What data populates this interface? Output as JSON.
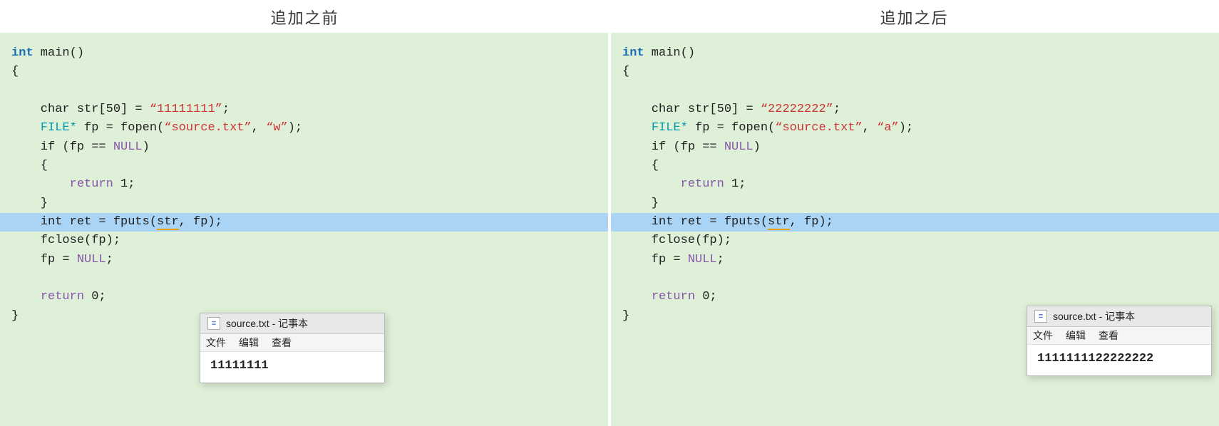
{
  "header": {
    "left_title": "追加之前",
    "right_title": "追加之后"
  },
  "left_panel": {
    "lines": [
      {
        "type": "normal",
        "parts": [
          {
            "text": "int",
            "cls": "kw"
          },
          {
            "text": " main()"
          }
        ]
      },
      {
        "type": "normal",
        "parts": [
          {
            "text": "{"
          }
        ]
      },
      {
        "type": "normal",
        "parts": []
      },
      {
        "type": "normal",
        "parts": [
          {
            "text": "    char str[50] = "
          },
          {
            "text": "“11111111”",
            "cls": "str"
          },
          {
            "text": ";"
          }
        ]
      },
      {
        "type": "normal",
        "parts": [
          {
            "text": "    "
          },
          {
            "text": "FILE*",
            "cls": "kw2"
          },
          {
            "text": " fp = fopen("
          },
          {
            "text": "“source.txt”",
            "cls": "str"
          },
          {
            "text": ", "
          },
          {
            "text": "“w”",
            "cls": "str"
          },
          {
            "text": ");"
          }
        ]
      },
      {
        "type": "normal",
        "parts": [
          {
            "text": "    if (fp == "
          },
          {
            "text": "NULL",
            "cls": "purple"
          },
          {
            "text": ")"
          }
        ]
      },
      {
        "type": "normal",
        "parts": [
          {
            "text": "    {"
          }
        ]
      },
      {
        "type": "normal",
        "parts": [
          {
            "text": "        "
          },
          {
            "text": "return",
            "cls": "purple"
          },
          {
            "text": " 1;"
          }
        ]
      },
      {
        "type": "normal",
        "parts": [
          {
            "text": "    }"
          }
        ]
      },
      {
        "type": "highlight",
        "parts": [
          {
            "text": "    int ret = fputs("
          },
          {
            "text": "str",
            "cls": "underline"
          },
          {
            "text": ", fp);"
          }
        ]
      },
      {
        "type": "normal",
        "parts": [
          {
            "text": "    fclose(fp);"
          }
        ]
      },
      {
        "type": "normal",
        "parts": [
          {
            "text": "    fp = "
          },
          {
            "text": "NULL",
            "cls": "purple"
          },
          {
            "text": ";"
          }
        ]
      },
      {
        "type": "normal",
        "parts": []
      },
      {
        "type": "normal",
        "parts": [
          {
            "text": "    "
          },
          {
            "text": "return",
            "cls": "purple"
          },
          {
            "text": " 0;"
          }
        ]
      },
      {
        "type": "normal",
        "parts": [
          {
            "text": "}"
          }
        ]
      }
    ]
  },
  "right_panel": {
    "lines": [
      {
        "type": "normal",
        "parts": [
          {
            "text": "int",
            "cls": "kw"
          },
          {
            "text": " main()"
          }
        ]
      },
      {
        "type": "normal",
        "parts": [
          {
            "text": "{"
          }
        ]
      },
      {
        "type": "normal",
        "parts": []
      },
      {
        "type": "normal",
        "parts": [
          {
            "text": "    char str[50] = "
          },
          {
            "text": "“22222222”",
            "cls": "str"
          },
          {
            "text": ";"
          }
        ]
      },
      {
        "type": "normal",
        "parts": [
          {
            "text": "    "
          },
          {
            "text": "FILE*",
            "cls": "kw2"
          },
          {
            "text": " fp = fopen("
          },
          {
            "text": "“source.txt”",
            "cls": "str"
          },
          {
            "text": ", "
          },
          {
            "text": "“a”",
            "cls": "str"
          },
          {
            "text": ");"
          }
        ]
      },
      {
        "type": "normal",
        "parts": [
          {
            "text": "    if (fp == "
          },
          {
            "text": "NULL",
            "cls": "purple"
          },
          {
            "text": ")"
          }
        ]
      },
      {
        "type": "normal",
        "parts": [
          {
            "text": "    {"
          }
        ]
      },
      {
        "type": "normal",
        "parts": [
          {
            "text": "        "
          },
          {
            "text": "return",
            "cls": "purple"
          },
          {
            "text": " 1;"
          }
        ]
      },
      {
        "type": "normal",
        "parts": [
          {
            "text": "    }"
          }
        ]
      },
      {
        "type": "highlight",
        "parts": [
          {
            "text": "    int ret = fputs("
          },
          {
            "text": "str",
            "cls": "underline"
          },
          {
            "text": ", fp);"
          }
        ]
      },
      {
        "type": "normal",
        "parts": [
          {
            "text": "    fclose(fp);"
          }
        ]
      },
      {
        "type": "normal",
        "parts": [
          {
            "text": "    fp = "
          },
          {
            "text": "NULL",
            "cls": "purple"
          },
          {
            "text": ";"
          }
        ]
      },
      {
        "type": "normal",
        "parts": []
      },
      {
        "type": "normal",
        "parts": [
          {
            "text": "    "
          },
          {
            "text": "return",
            "cls": "purple"
          },
          {
            "text": " 0;"
          }
        ]
      },
      {
        "type": "normal",
        "parts": [
          {
            "text": "}"
          }
        ]
      }
    ]
  },
  "notepad_left": {
    "title": "source.txt - 记事本",
    "menu": [
      "文件",
      "编辑",
      "查看"
    ],
    "content": "11111111"
  },
  "notepad_right": {
    "title": "source.txt - 记事本",
    "menu": [
      "文件",
      "编辑",
      "查看"
    ],
    "content": "1111111122222222"
  }
}
